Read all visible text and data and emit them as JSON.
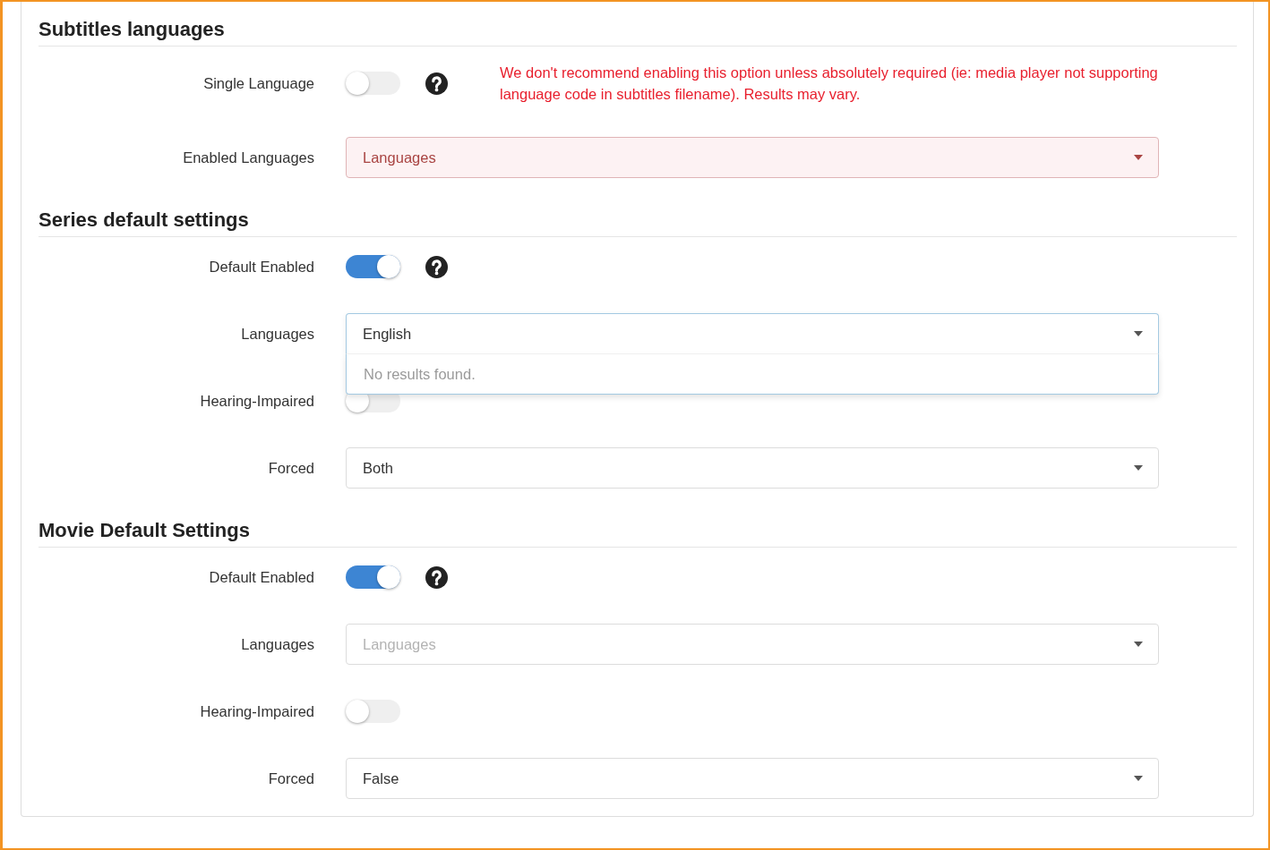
{
  "sections": [
    {
      "title": "Subtitles languages",
      "fields": [
        {
          "kind": "toggle",
          "label": "Single Language",
          "on": false,
          "help": true,
          "note": "We don't recommend enabling this option unless absolutely required (ie: media player not supporting language code in subtitles filename). Results may vary."
        },
        {
          "kind": "select",
          "label": "Enabled Languages",
          "placeholder": "Languages",
          "invalid": true,
          "expanded": false
        }
      ]
    },
    {
      "title": "Series default settings",
      "fields": [
        {
          "kind": "toggle",
          "label": "Default Enabled",
          "on": true,
          "help": true
        },
        {
          "kind": "select",
          "label": "Languages",
          "value": "English",
          "invalid": false,
          "expanded": true,
          "menu_message": "No results found."
        },
        {
          "kind": "toggle",
          "label": "Hearing-Impaired",
          "on": false
        },
        {
          "kind": "select",
          "label": "Forced",
          "value": "Both",
          "invalid": false,
          "expanded": false
        }
      ]
    },
    {
      "title": "Movie Default Settings",
      "fields": [
        {
          "kind": "toggle",
          "label": "Default Enabled",
          "on": true,
          "help": true
        },
        {
          "kind": "select",
          "label": "Languages",
          "placeholder": "Languages",
          "invalid": false,
          "expanded": false
        },
        {
          "kind": "toggle",
          "label": "Hearing-Impaired",
          "on": false
        },
        {
          "kind": "select",
          "label": "Forced",
          "value": "False",
          "invalid": false,
          "expanded": false
        }
      ]
    }
  ]
}
